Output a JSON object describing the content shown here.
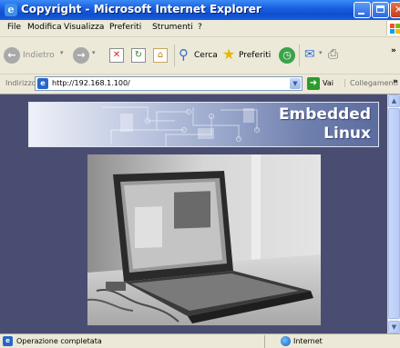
{
  "window": {
    "title": "Copyright - Microsoft Internet Explorer",
    "app_icon": "ie-icon"
  },
  "menubar": {
    "items": [
      "File",
      "Modifica",
      "Visualizza",
      "Preferiti",
      "Strumenti",
      "?"
    ]
  },
  "toolbar": {
    "back_label": "Indietro",
    "search_label": "Cerca",
    "favorites_label": "Preferiti",
    "overflow": "»"
  },
  "addressbar": {
    "label": "Indirizzo",
    "url": "http://192.168.1.100/",
    "go_label": "Vai",
    "links_label": "Collegamenti",
    "overflow": "»"
  },
  "page": {
    "banner_line1": "Embedded",
    "banner_line2": "Linux",
    "background_color": "#4a4d72",
    "photo_subject": "laptop-photo"
  },
  "statusbar": {
    "text": "Operazione completata",
    "zone": "Internet"
  }
}
